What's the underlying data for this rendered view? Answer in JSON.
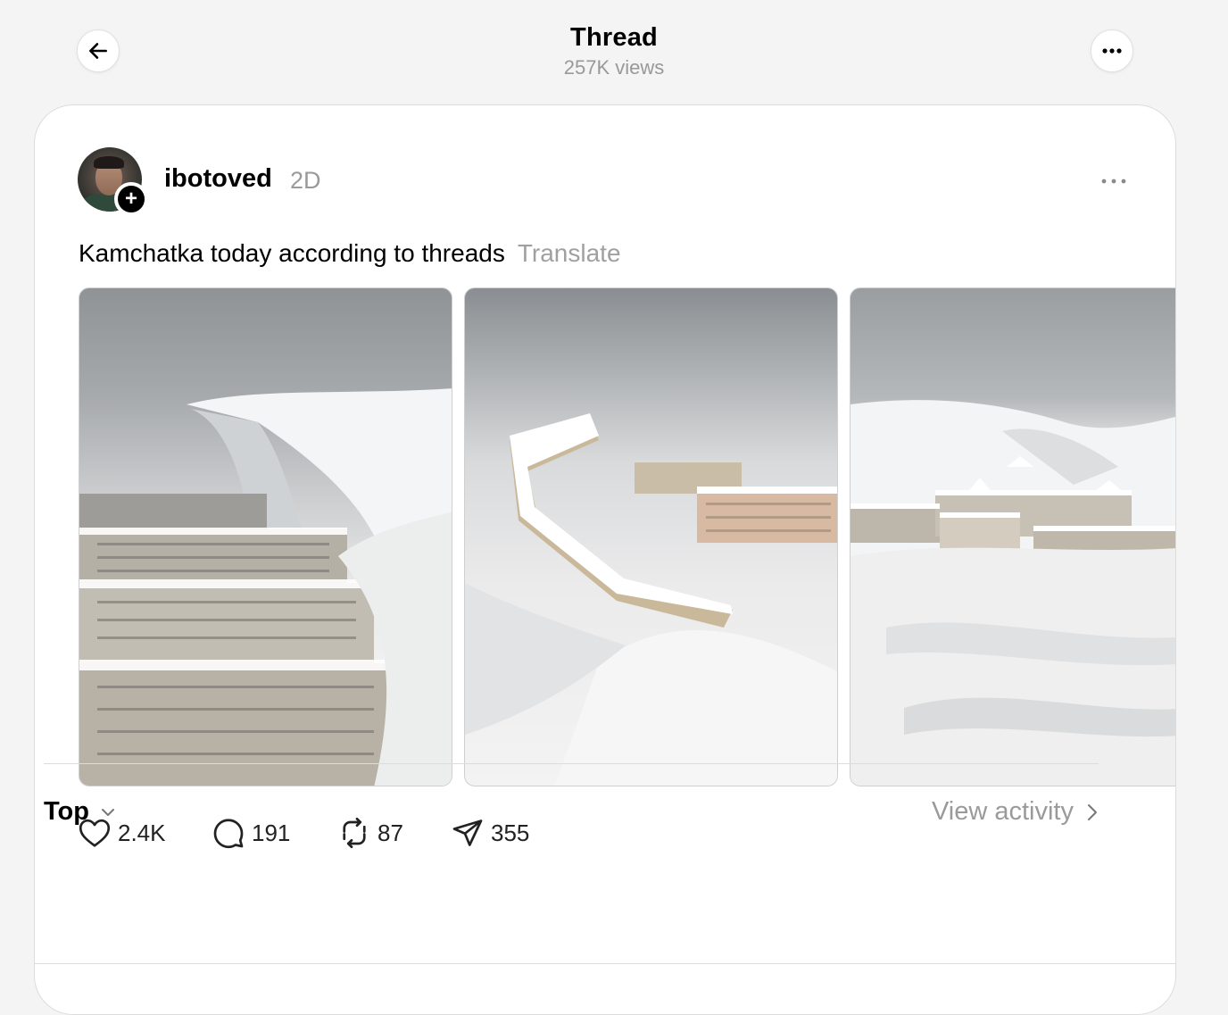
{
  "header": {
    "title": "Thread",
    "views": "257K views"
  },
  "post": {
    "username": "ibotoved",
    "timestamp": "2D",
    "text": "Kamchatka today according to threads",
    "translate_label": "Translate",
    "images": [
      {
        "alt": "Snow-covered apartment blocks beside a huge snow drift"
      },
      {
        "alt": "Long apartment building buried in snow under fog"
      },
      {
        "alt": "Buildings buried in snow dunes"
      }
    ],
    "actions": {
      "likes": "2.4K",
      "replies": "191",
      "reposts": "87",
      "shares": "355"
    }
  },
  "replies_bar": {
    "sort_label": "Top",
    "view_activity_label": "View activity"
  }
}
